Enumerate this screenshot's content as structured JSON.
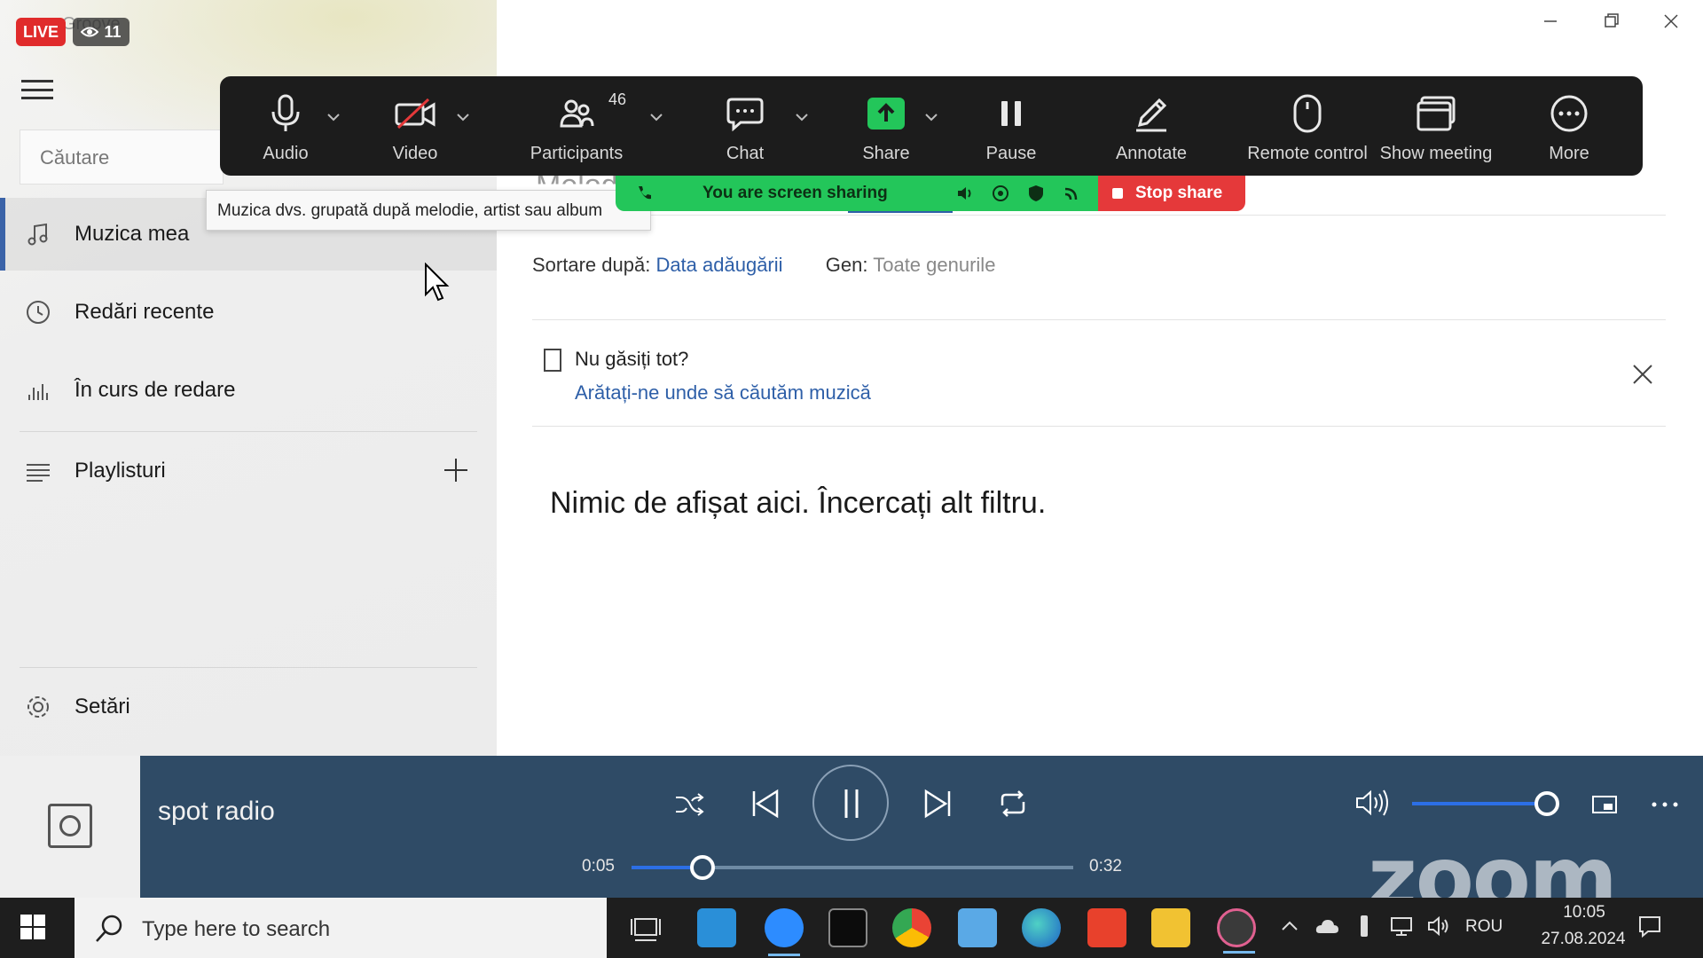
{
  "overlay": {
    "live_label": "LIVE",
    "viewer_count": "11",
    "app_title_peek": "Groove"
  },
  "sidebar": {
    "search_placeholder": "Căutare",
    "items": [
      {
        "label": "Muzica mea",
        "icon": "music-note-icon",
        "selected": true
      },
      {
        "label": "Redări recente",
        "icon": "clock-icon"
      },
      {
        "label": "În curs de redare",
        "icon": "equalizer-icon"
      },
      {
        "label": "Playlisturi",
        "icon": "playlist-icon"
      }
    ],
    "settings_label": "Setări"
  },
  "tooltip": {
    "text": "Muzica dvs. grupată după melodie, artist sau album"
  },
  "main": {
    "header_peek": "Melodii",
    "sort_label": "Sortare după:",
    "sort_value": "Data adăugării",
    "genre_label": "Gen:",
    "genre_value": "Toate genurile",
    "notice_title": "Nu găsiți tot?",
    "notice_link": "Arătați-ne unde să căutăm muzică",
    "empty_message": "Nimic de afișat aici. Încercați alt filtru."
  },
  "zoom": {
    "toolbar": [
      {
        "label": "Audio",
        "icon": "microphone-icon"
      },
      {
        "label": "Video",
        "icon": "video-off-icon"
      },
      {
        "label": "Participants",
        "icon": "participants-icon"
      },
      {
        "label": "Chat",
        "icon": "chat-icon"
      },
      {
        "label": "Share",
        "icon": "share-screen-icon"
      },
      {
        "label": "Pause",
        "icon": "pause-icon"
      },
      {
        "label": "Annotate",
        "icon": "pencil-icon"
      },
      {
        "label": "Remote control",
        "icon": "mouse-icon"
      },
      {
        "label": "Show meeting",
        "icon": "window-icon"
      },
      {
        "label": "More",
        "icon": "ellipsis-icon"
      }
    ],
    "participant_count": "46",
    "sharing_text": "You are screen sharing",
    "stop_share_label": "Stop share",
    "watermark": "zoom"
  },
  "player": {
    "track_title": "spot radio",
    "elapsed": "0:05",
    "duration": "0:32",
    "progress_fraction": 0.16,
    "volume_fraction": 1.0
  },
  "taskbar": {
    "search_placeholder": "Type here to search",
    "language": "ROU",
    "time": "10:05",
    "date": "27.08.2024"
  },
  "colors": {
    "player_bg": "#2f4b66",
    "accent_blue": "#2e5fa8",
    "zoom_bar_bg": "#1c1c1c",
    "share_green": "#23c65a",
    "stop_red": "#e5393a",
    "live_red": "#e02b2b"
  }
}
